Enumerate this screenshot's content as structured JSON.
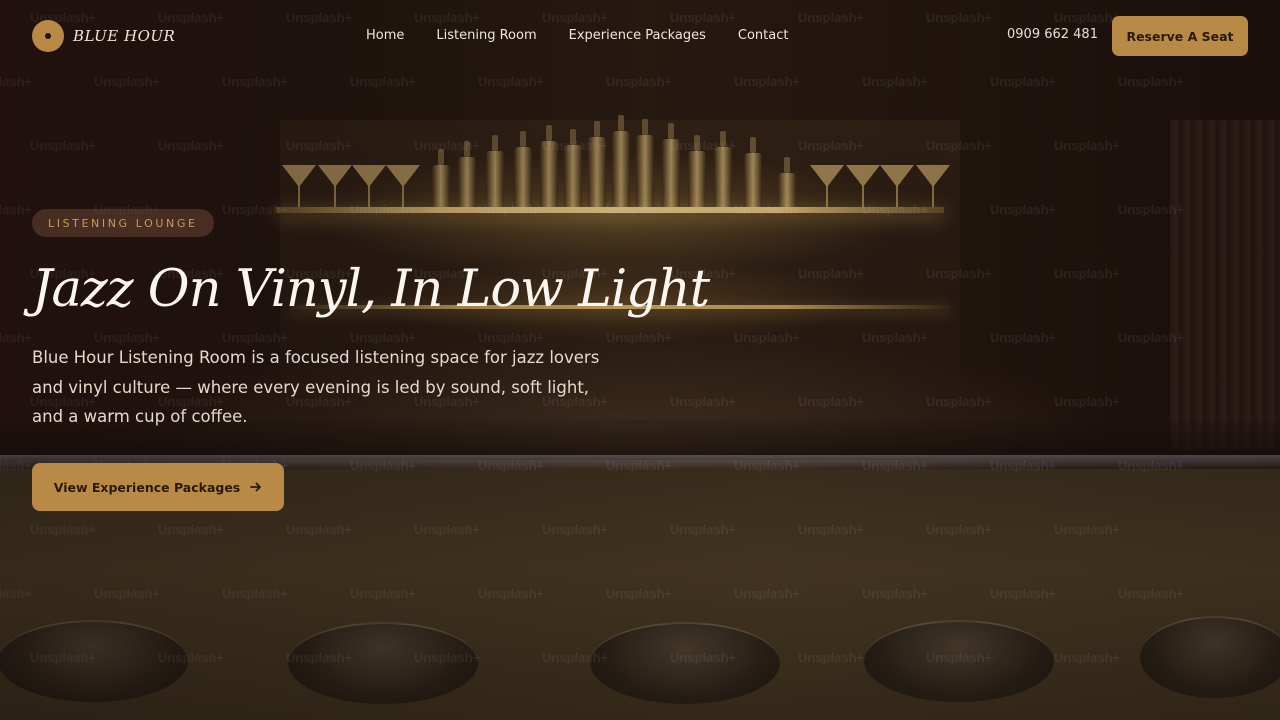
{
  "brand": {
    "name": "BLUE HOUR"
  },
  "nav": {
    "links": [
      "Home",
      "Listening Room",
      "Experience Packages",
      "Contact"
    ],
    "phone": "0909 662 481",
    "reserve_label": "Reserve A Seat"
  },
  "hero": {
    "badge": "LISTENING LOUNGE",
    "title": "Jazz On Vinyl, In Low Light",
    "subtitle": "Blue Hour Listening Room is a focused listening space for jazz lovers and vinyl culture — where every evening is led by sound, soft light, and a warm cup of coffee.",
    "cta_label": "View Experience Packages",
    "cta_icon": "arrow-right-icon"
  },
  "watermark": "Unsplash+",
  "colors": {
    "accent": "#b98a45",
    "badge_text": "#c99a55",
    "heading": "#fbf7f0"
  }
}
